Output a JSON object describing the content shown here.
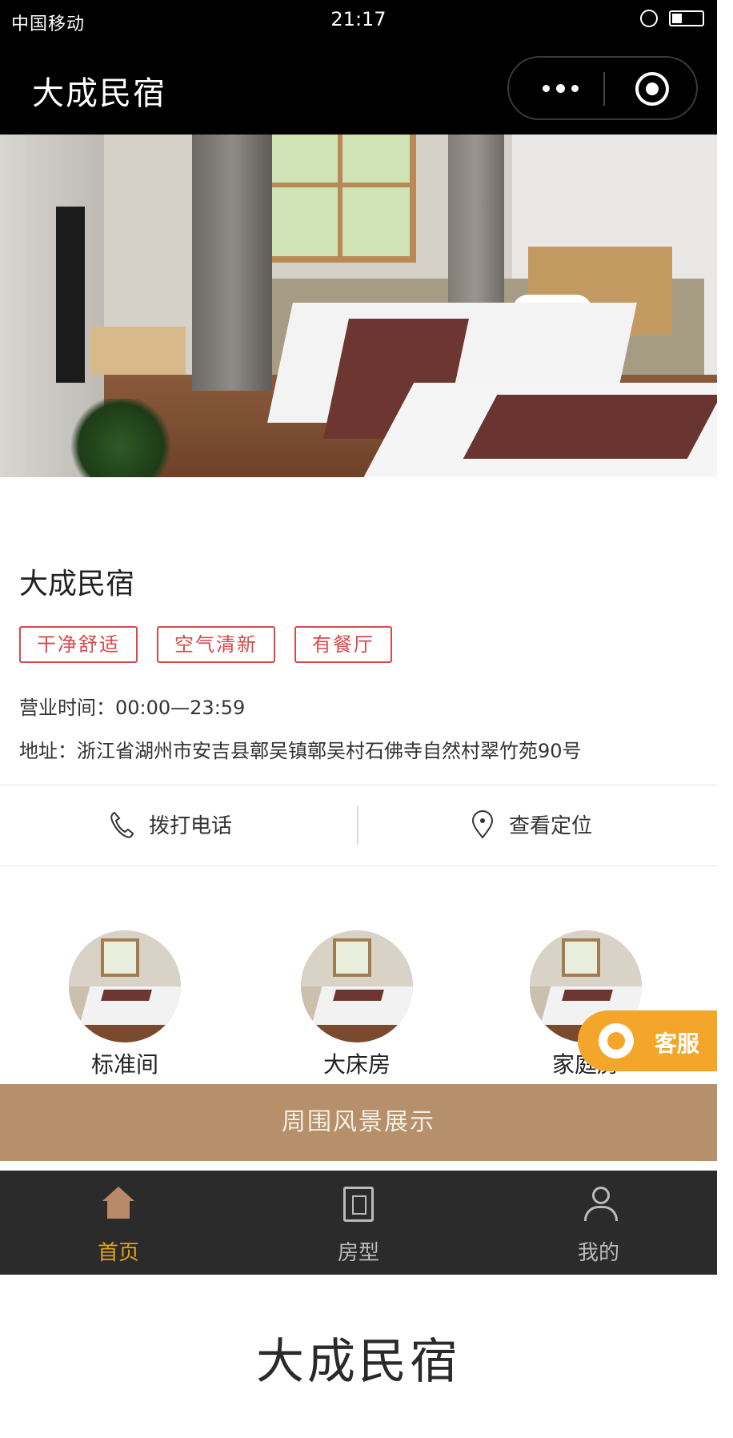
{
  "status_bar": {
    "signal": "中国移动",
    "time": "21:17"
  },
  "header": {
    "title": "大成民宿"
  },
  "hotel": {
    "name": "大成民宿",
    "tags": [
      "干净舒适",
      "空气清新",
      "有餐厅"
    ],
    "hours_label": "营业时间：",
    "hours_value": "00:00—23:59",
    "address_label": "地址：",
    "address_value": "浙江省湖州市安吉县鄣吴镇鄣吴村石佛寺自然村翠竹苑90号"
  },
  "actions": {
    "call_label": "拨打电话",
    "navigate_label": "查看定位"
  },
  "rooms": [
    {
      "name": "标准间"
    },
    {
      "name": "大床房"
    },
    {
      "name": "家庭房"
    }
  ],
  "service": {
    "label": "客服"
  },
  "banner": {
    "text": "周围风景展示"
  },
  "tabbar": {
    "items": [
      {
        "label": "首页",
        "active": true
      },
      {
        "label": "房型"
      },
      {
        "label": "我的"
      }
    ]
  },
  "footer": {
    "title": "大成民宿"
  },
  "colors": {
    "header_bg": "#000000",
    "tag_red": "#d64a4a",
    "banner": "#b5906a",
    "tabbar_bg": "#2b2b2b",
    "tab_active": "#e0a21d",
    "service_orange": "#f4a62a"
  }
}
